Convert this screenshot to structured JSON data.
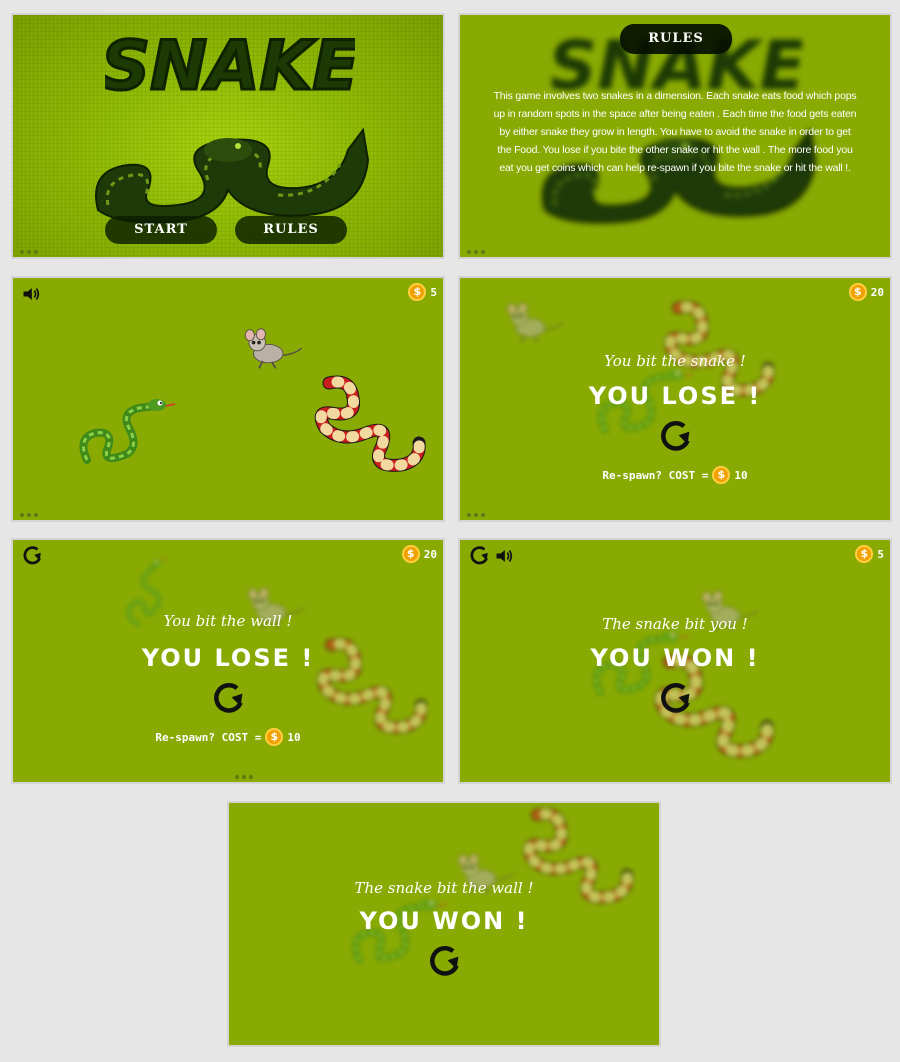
{
  "screens": {
    "menu": {
      "logo_text": "SNAKE",
      "start_label": "START",
      "rules_label": "RULES"
    },
    "rules": {
      "title": "RULES",
      "body": "This game involves two snakes in a dimension. Each snake eats food which pops up in random spots in the space after being eaten . Each time the food gets eaten by either snake they grow in length. You have to avoid the snake in order to get the Food. You lose if you bite the other snake or hit the wall . The more food you eat you get coins which can help re-spawn if you bite the snake or hit the wall !."
    },
    "gameplay": {
      "coins": "5",
      "sound_icon": "speaker-icon"
    },
    "lose_snake": {
      "coins": "20",
      "subtitle": "You bit the snake !",
      "title": "YOU LOSE !",
      "respawn_label": "Re-spawn? COST =",
      "respawn_cost": "10"
    },
    "lose_wall": {
      "coins": "20",
      "subtitle": "You bit the wall !",
      "title": "YOU LOSE !",
      "respawn_label": "Re-spawn? COST =",
      "respawn_cost": "10"
    },
    "won_bit": {
      "coins": "5",
      "subtitle": "The snake bit you !",
      "title": "YOU WON !"
    },
    "won_wall": {
      "subtitle": "The snake bit the wall !",
      "title": "YOU WON !"
    }
  },
  "coin_symbol": "$",
  "colors": {
    "field": "#89aa02",
    "coin": "#f0a000",
    "text": "#ffffff",
    "button_bg": "#0a1e00"
  }
}
